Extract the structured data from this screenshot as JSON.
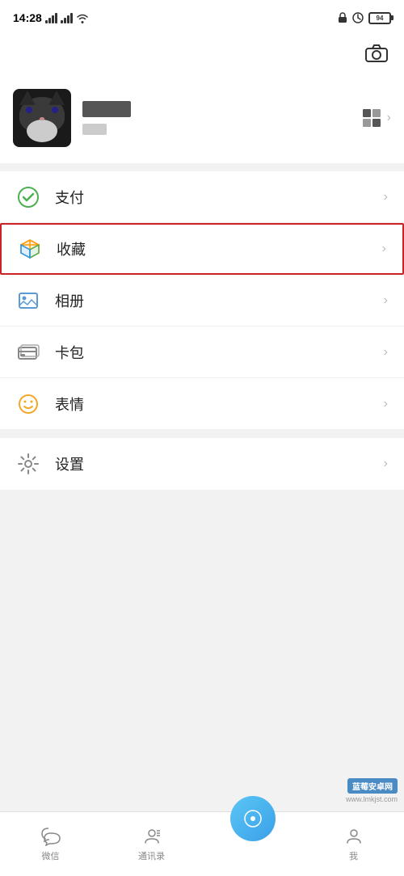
{
  "statusBar": {
    "time": "14:28",
    "battery": "94"
  },
  "header": {
    "cameraLabel": "📷"
  },
  "profile": {
    "nameBoxVisible": true,
    "qrLabel": "QR"
  },
  "menu": {
    "items": [
      {
        "id": "pay",
        "label": "支付",
        "iconType": "pay"
      },
      {
        "id": "favorites",
        "label": "收藏",
        "iconType": "favorites",
        "highlighted": true
      },
      {
        "id": "album",
        "label": "相册",
        "iconType": "album"
      },
      {
        "id": "cards",
        "label": "卡包",
        "iconType": "cards"
      },
      {
        "id": "emoji",
        "label": "表情",
        "iconType": "emoji"
      },
      {
        "id": "settings",
        "label": "设置",
        "iconType": "settings"
      }
    ]
  },
  "bottomNav": {
    "items": [
      {
        "id": "wechat",
        "label": "微信",
        "iconType": "chat"
      },
      {
        "id": "contacts",
        "label": "通讯录",
        "iconType": "contacts"
      },
      {
        "id": "discover",
        "label": "",
        "iconType": "discover"
      },
      {
        "id": "me",
        "label": "我",
        "iconType": "me"
      }
    ]
  },
  "watermark": {
    "site": "蓝莓安卓网",
    "url": "www.lmkjst.com"
  }
}
